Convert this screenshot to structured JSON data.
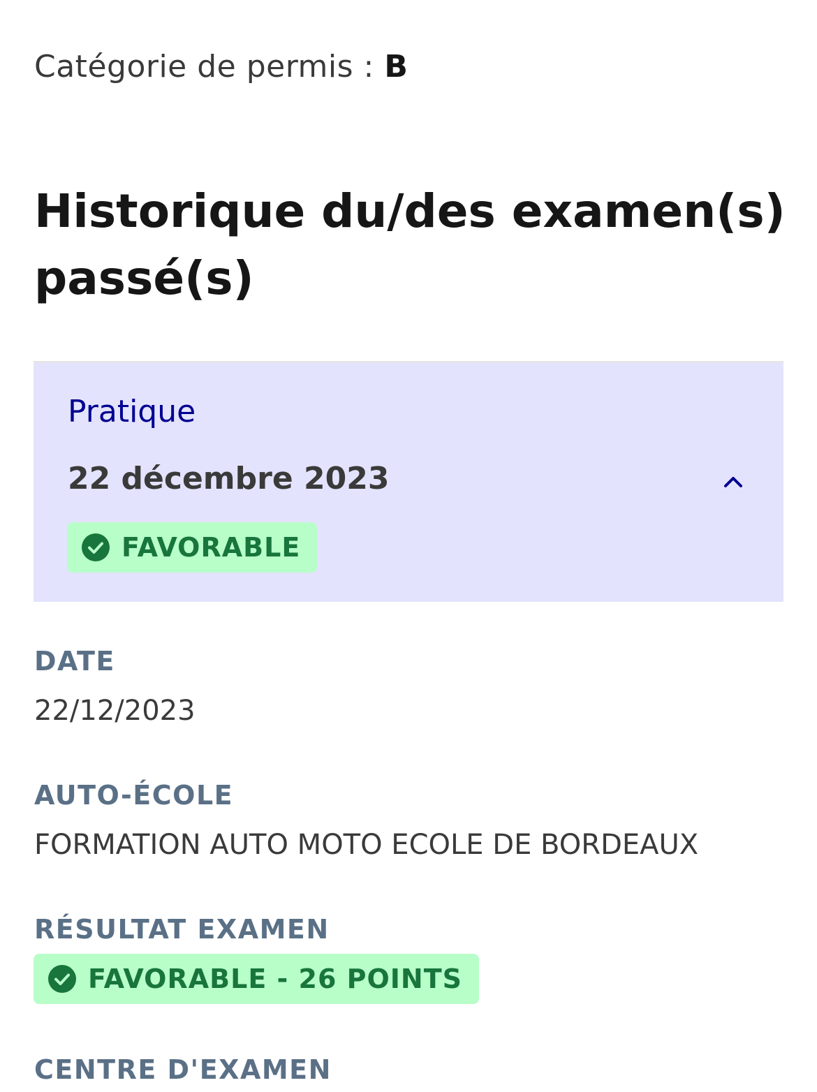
{
  "permis": {
    "label": "Catégorie de permis : ",
    "value": "B"
  },
  "title": "Historique du/des examen(s) passé(s)",
  "accordion": {
    "type": "Pratique",
    "date": "22 décembre 2023",
    "badge": "FAVORABLE",
    "expanded": true,
    "chevron_icon": "chevron-up-icon"
  },
  "details": {
    "date_label": "DATE",
    "date_value": "22/12/2023",
    "school_label": "AUTO-ÉCOLE",
    "school_value": "FORMATION AUTO MOTO ECOLE DE BORDEAUX",
    "result_label": "RÉSULTAT EXAMEN",
    "result_badge": "FAVORABLE - 26 POINTS",
    "center_label": "CENTRE D'EXAMEN"
  },
  "colors": {
    "accent": "#000091",
    "accordion_bg": "#e3e3fd",
    "success_bg": "#b8fec9",
    "success_text": "#18753c",
    "label_text": "#5a7086"
  }
}
